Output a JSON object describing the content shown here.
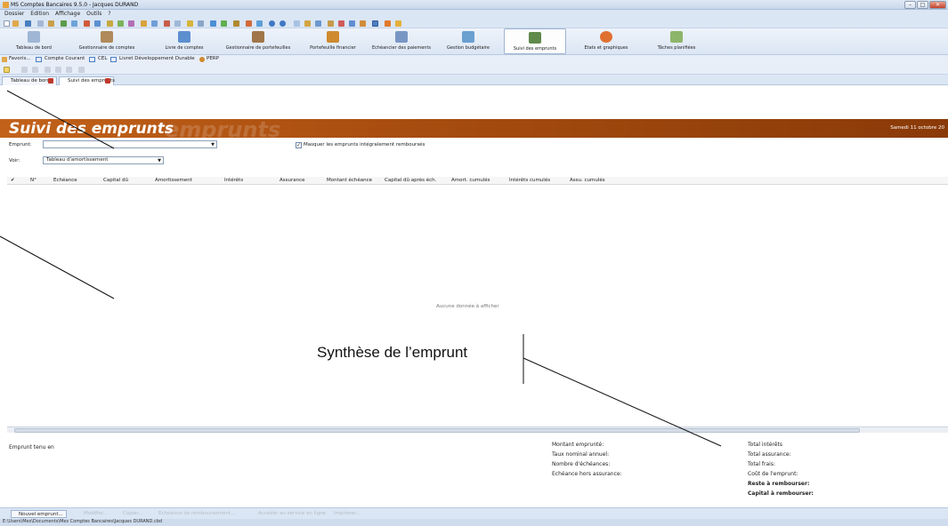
{
  "window": {
    "title": "MS Comptes Bancaires 9.5.0 - Jacques DURAND"
  },
  "menu": [
    "Dossier",
    "Edition",
    "Affichage",
    "Outils",
    "?"
  ],
  "ribbon": [
    {
      "label": "Tableau de bord",
      "icon": "dashboard-icon",
      "color": "#9fb6d4"
    },
    {
      "label": "Gestionnaire de comptes",
      "icon": "bank-icon",
      "color": "#b08a5a"
    },
    {
      "label": "Livre de comptes",
      "icon": "book-icon",
      "color": "#5d8fcf"
    },
    {
      "label": "Gestionnaire de portefeuilles",
      "icon": "briefcase-icon",
      "color": "#a0764a"
    },
    {
      "label": "Portefeuille financier",
      "icon": "money-bag-icon",
      "color": "#d08a2e"
    },
    {
      "label": "Echéancier des paiements",
      "icon": "calendar-icon",
      "color": "#7896c4"
    },
    {
      "label": "Gestion budgétaire",
      "icon": "calculator-icon",
      "color": "#6a9fd0"
    },
    {
      "label": "Suivi des emprunts",
      "icon": "house-icon",
      "color": "#5f8a4a"
    },
    {
      "label": "Etats et graphiques",
      "icon": "pie-chart-icon",
      "color": "#e07030"
    },
    {
      "label": "Tâches planifiées",
      "icon": "task-icon",
      "color": "#8db56a"
    }
  ],
  "favorites": [
    "Favoris...",
    "Compte Courant",
    "CEL",
    "Livret Développement Durable",
    "PERP"
  ],
  "tabs": [
    "Tableau de bord",
    "Suivi des emprunts"
  ],
  "header": {
    "title": "Suivi des emprunts",
    "watermark": "emprunts",
    "date": "Samedi 11 octobre 20"
  },
  "form": {
    "emprunt_label": "Emprunt:",
    "emprunt_value": "",
    "masquer_label": "Masquer les emprunts intégralement remboursés",
    "masquer_checked": "✓",
    "voir_label": "Voir:",
    "voir_value": "Tableau d'amortissement"
  },
  "table": {
    "check": "✔",
    "columns": [
      "N°",
      "Echéance",
      "Capital dû",
      "Amortissement",
      "Intérêts",
      "Assurance",
      "Montant échéance",
      "Capital dû après éch.",
      "Amort. cumulés",
      "Intérêts cumulés",
      "Assu. cumulés"
    ],
    "empty": "Aucune donnée à afficher"
  },
  "annotation": "Synthèse de l’emprunt",
  "summary": {
    "emprunt_tenu": "Emprunt tenu en",
    "middle": [
      "Montant emprunté:",
      "Taux nominal annuel:",
      "Nombre d'échéances:",
      "Echéance hors assurance:"
    ],
    "right": [
      "Total intérêts",
      "Total assurance:",
      "Total frais:",
      "Coût de l'emprunt:"
    ],
    "right_bold": [
      "Reste à rembourser:",
      "Capital à rembourser:"
    ]
  },
  "bottom_buttons": [
    "Nouvel emprunt...",
    "Modifier...",
    "Copier...",
    "Echéance de remboursement...",
    "Accéder au service en ligne",
    "Imprimer..."
  ],
  "status": "E:\\Users\\Mes\\Documents\\Mes Comptes Bancaires\\Jacques DURAND.cbd"
}
